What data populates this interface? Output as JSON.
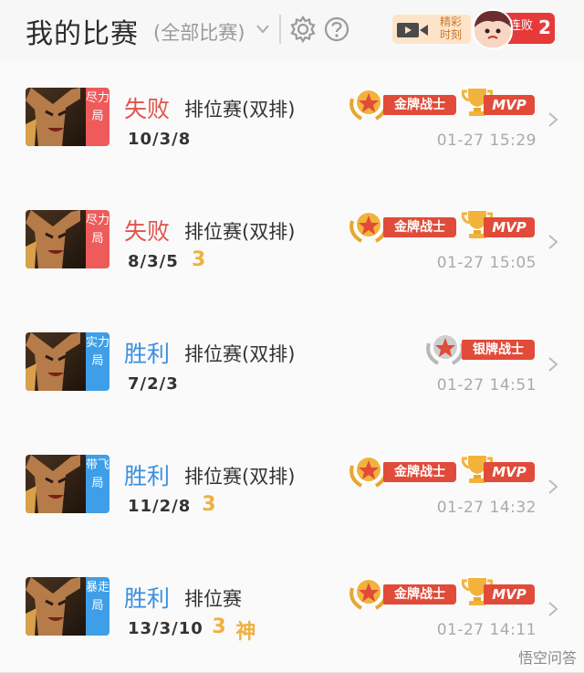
{
  "header": {
    "title": "我的比赛",
    "filter": "(全部比赛)",
    "highlight_label_1": "精彩",
    "highlight_label_2": "时刻",
    "streak_label": "连败",
    "streak_count": "2"
  },
  "matches": [
    {
      "tag": "尽力局",
      "tag_color": "#ee5b5b",
      "result": "失败",
      "mode": "排位赛(双排)",
      "kda": "10/3/8",
      "extra_triple": "",
      "extra_god": "",
      "badge": "金牌战士",
      "mvp": "MVP",
      "time": "01-27 15:29"
    },
    {
      "tag": "尽力局",
      "tag_color": "#ee5b5b",
      "result": "失败",
      "mode": "排位赛(双排)",
      "kda": "8/3/5",
      "extra_triple": "3",
      "extra_god": "",
      "badge": "金牌战士",
      "mvp": "MVP",
      "time": "01-27 15:05"
    },
    {
      "tag": "实力局",
      "tag_color": "#3f9ee8",
      "result": "胜利",
      "mode": "排位赛(双排)",
      "kda": "7/2/3",
      "extra_triple": "",
      "extra_god": "",
      "badge": "银牌战士",
      "mvp": "",
      "time": "01-27 14:51"
    },
    {
      "tag": "带飞局",
      "tag_color": "#3f9ee8",
      "result": "胜利",
      "mode": "排位赛(双排)",
      "kda": "11/2/8",
      "extra_triple": "3",
      "extra_god": "",
      "badge": "金牌战士",
      "mvp": "MVP",
      "time": "01-27 14:32"
    },
    {
      "tag": "暴走局",
      "tag_color": "#3f9ee8",
      "result": "胜利",
      "mode": "排位赛",
      "kda": "13/3/10",
      "extra_triple": "3",
      "extra_god": "神",
      "badge": "金牌战士",
      "mvp": "MVP",
      "time": "01-27 14:11"
    }
  ],
  "watermark": "悟空问答",
  "icons": {
    "filter_chevron": "chevron-down-icon",
    "settings": "gear-icon",
    "help": "question-icon",
    "video": "video-camera-icon",
    "row_arrow": "chevron-right-icon"
  }
}
